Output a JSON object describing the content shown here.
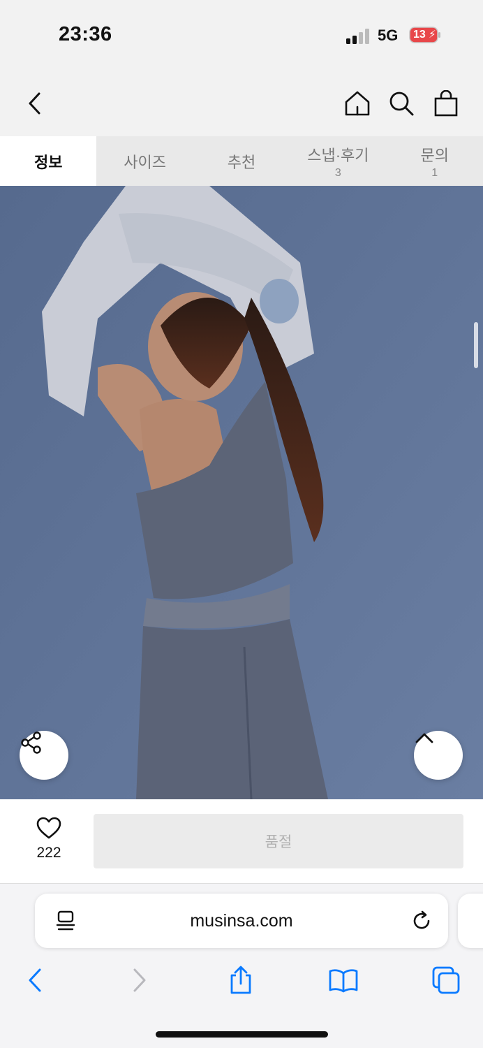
{
  "status_bar": {
    "time": "23:36",
    "network": "5G",
    "battery": "13"
  },
  "header": {
    "icons": [
      "back-icon",
      "home-icon",
      "search-icon",
      "shopping-bag-icon"
    ]
  },
  "tabs": [
    {
      "label": "정보",
      "count": ""
    },
    {
      "label": "사이즈",
      "count": ""
    },
    {
      "label": "추천",
      "count": ""
    },
    {
      "label": "스냅·후기",
      "count": "3"
    },
    {
      "label": "문의",
      "count": "1"
    }
  ],
  "active_tab": "정보",
  "product": {
    "likes": "222",
    "buy_button_label": "품절"
  },
  "browser": {
    "url": "musinsa.com"
  },
  "colors": {
    "accent_blue": "#0a7aff",
    "photo_background": "#5f7396"
  }
}
